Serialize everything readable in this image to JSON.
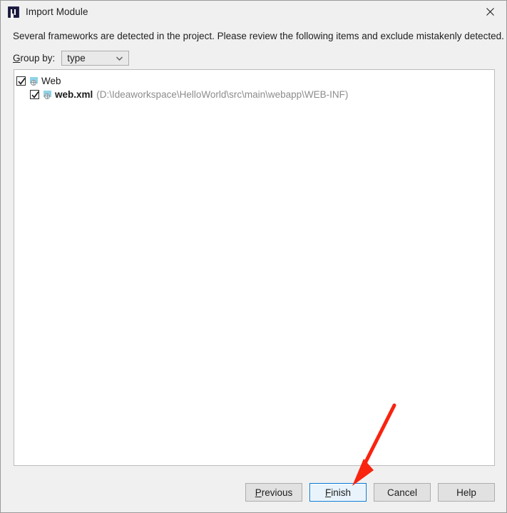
{
  "window": {
    "title": "Import Module",
    "app_icon": "intellij-idea-icon",
    "close_icon": "close-icon"
  },
  "description": "Several frameworks are detected in the project. Please review the following items and exclude mistakenly detected.",
  "group_by": {
    "label_prefix": "G",
    "label_rest": "roup by:",
    "selected": "type",
    "options": [
      "type"
    ],
    "arrow_icon": "chevron-down-icon"
  },
  "tree": {
    "nodes": [
      {
        "label": "Web",
        "checked": true,
        "icon": "web-framework-icon",
        "path": "",
        "children": [
          {
            "label": "web.xml",
            "checked": true,
            "icon": "web-xml-icon",
            "path": "(D:\\Ideaworkspace\\HelloWorld\\src\\main\\webapp\\WEB-INF)"
          }
        ]
      }
    ]
  },
  "buttons": {
    "previous": {
      "prefix": "P",
      "mnemonic": "",
      "text_before": "",
      "label": "Previous",
      "mnemonic_char": "P",
      "rest": "revious"
    },
    "finish": {
      "mnemonic_char": "F",
      "rest": "inish",
      "label": "Finish"
    },
    "cancel": {
      "label": "Cancel"
    },
    "help": {
      "label": "Help"
    }
  },
  "annotation": {
    "arrow_color": "#f92310",
    "points_to": "finish-button"
  }
}
